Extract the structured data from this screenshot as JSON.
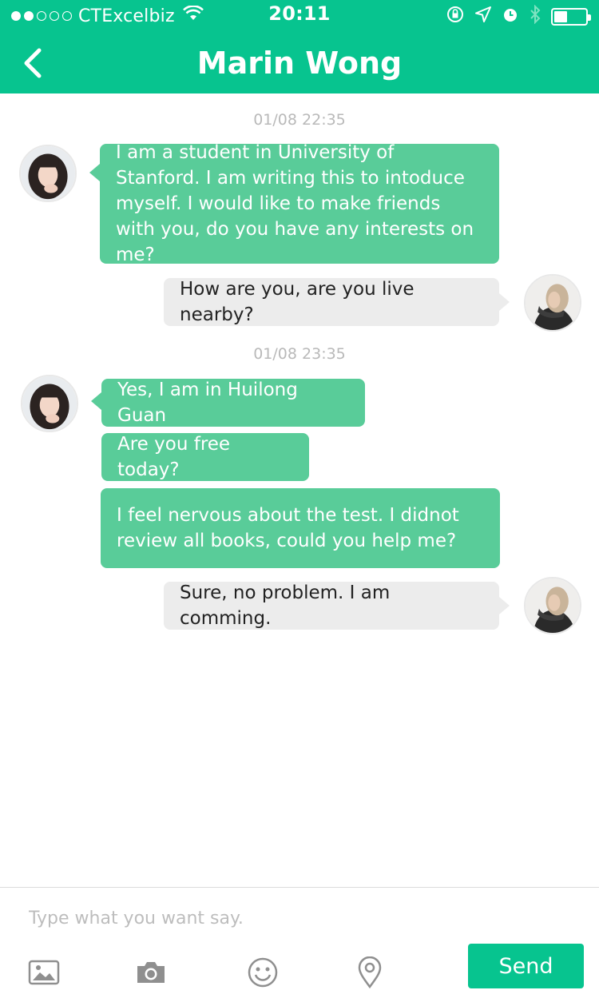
{
  "status_bar": {
    "carrier": "CTExcelbiz",
    "time": "20:11"
  },
  "nav": {
    "title": "Marin Wong"
  },
  "chat": {
    "timestamps": [
      "01/08  22:35",
      "01/08  23:35"
    ],
    "messages": [
      {
        "from": "them",
        "text": "I am a student in University of Stanford. I am writing this to intoduce myself. I would like to make friends with you, do you have any interests on me?"
      },
      {
        "from": "me",
        "text": "How are you, are you live nearby?"
      },
      {
        "from": "them",
        "text": "Yes, I am in Huilong Guan"
      },
      {
        "from": "them",
        "text": "Are you free today?"
      },
      {
        "from": "them",
        "text": "I feel nervous about the test. I didnot review all books, could you help me?"
      },
      {
        "from": "me",
        "text": "Sure, no problem. I am comming."
      }
    ]
  },
  "composer": {
    "placeholder": "Type what you want say.",
    "value": "",
    "send_label": "Send",
    "tools": [
      "image-icon",
      "camera-icon",
      "emoji-icon",
      "location-icon"
    ]
  },
  "colors": {
    "brand": "#07c48f",
    "incoming_bubble": "#59cc99",
    "outgoing_bubble": "#ececec"
  }
}
